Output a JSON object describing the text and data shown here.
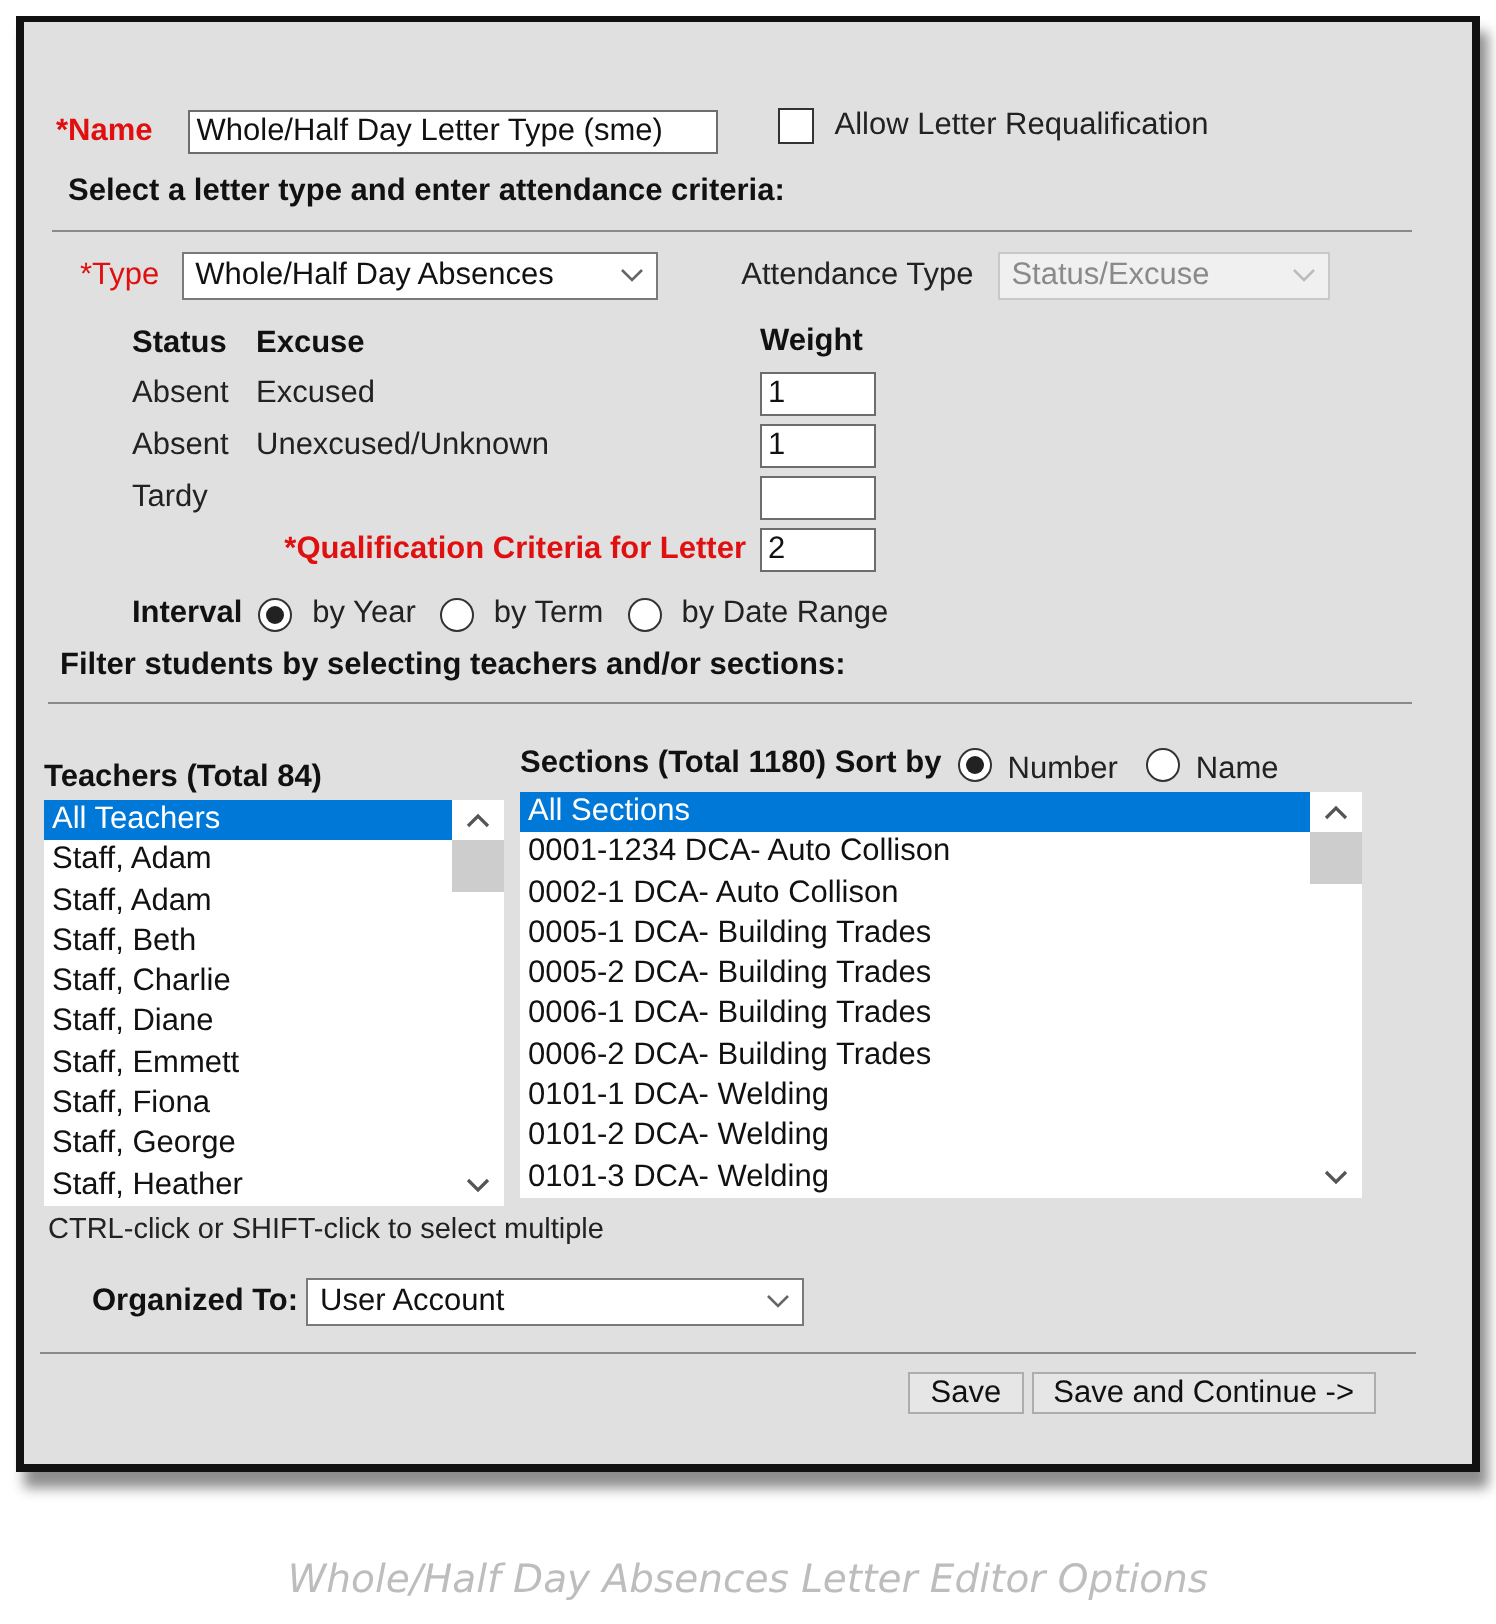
{
  "name_field": {
    "label": "*Name",
    "value": "Whole/Half Day Letter Type (sme)"
  },
  "requalification": {
    "label": "Allow Letter Requalification",
    "checked": false
  },
  "criteria_heading": "Select a letter type and enter attendance criteria:",
  "type_select": {
    "label": "*Type",
    "value": "Whole/Half Day Absences"
  },
  "attendance_type": {
    "label": "Attendance Type",
    "value": "Status/Excuse",
    "disabled": true
  },
  "weights_table": {
    "columns": [
      "Status",
      "Excuse",
      "Weight"
    ],
    "rows": [
      {
        "status": "Absent",
        "excuse": "Excused",
        "weight": "1"
      },
      {
        "status": "Absent",
        "excuse": "Unexcused/Unknown",
        "weight": "1"
      },
      {
        "status": "Tardy",
        "excuse": "",
        "weight": ""
      }
    ]
  },
  "qualification": {
    "label": "*Qualification Criteria for Letter",
    "value": "2"
  },
  "interval": {
    "label": "Interval",
    "options": [
      {
        "label": "by Year",
        "selected": true
      },
      {
        "label": "by Term",
        "selected": false
      },
      {
        "label": "by Date Range",
        "selected": false
      }
    ]
  },
  "filter_heading": "Filter students by selecting teachers and/or sections:",
  "teachers": {
    "label": "Teachers (Total 84)",
    "items": [
      {
        "label": "All Teachers",
        "selected": true
      },
      {
        "label": "Staff, Adam",
        "selected": false
      },
      {
        "label": "Staff, Adam",
        "selected": false
      },
      {
        "label": "Staff, Beth",
        "selected": false
      },
      {
        "label": "Staff, Charlie",
        "selected": false
      },
      {
        "label": "Staff, Diane",
        "selected": false
      },
      {
        "label": "Staff, Emmett",
        "selected": false
      },
      {
        "label": "Staff, Fiona",
        "selected": false
      },
      {
        "label": "Staff, George",
        "selected": false
      },
      {
        "label": "Staff, Heather",
        "selected": false
      }
    ]
  },
  "sections": {
    "label": "Sections (Total 1180) Sort by",
    "sort_options": [
      {
        "label": "Number",
        "selected": true
      },
      {
        "label": "Name",
        "selected": false
      }
    ],
    "items": [
      {
        "label": "All Sections",
        "selected": true
      },
      {
        "label": "0001-1234 DCA- Auto Collison",
        "selected": false
      },
      {
        "label": "0002-1 DCA- Auto Collison",
        "selected": false
      },
      {
        "label": "0005-1 DCA- Building Trades",
        "selected": false
      },
      {
        "label": "0005-2 DCA- Building Trades",
        "selected": false
      },
      {
        "label": "0006-1 DCA- Building Trades",
        "selected": false
      },
      {
        "label": "0006-2 DCA- Building Trades",
        "selected": false
      },
      {
        "label": "0101-1 DCA- Welding",
        "selected": false
      },
      {
        "label": "0101-2 DCA- Welding",
        "selected": false
      },
      {
        "label": "0101-3 DCA- Welding",
        "selected": false
      }
    ]
  },
  "hint": "CTRL-click or SHIFT-click to select multiple",
  "organized_to": {
    "label": "Organized To:",
    "value": "User Account"
  },
  "buttons": [
    "Save",
    "Save and Continue ->"
  ],
  "caption": "Whole/Half Day Absences Letter Editor Options"
}
